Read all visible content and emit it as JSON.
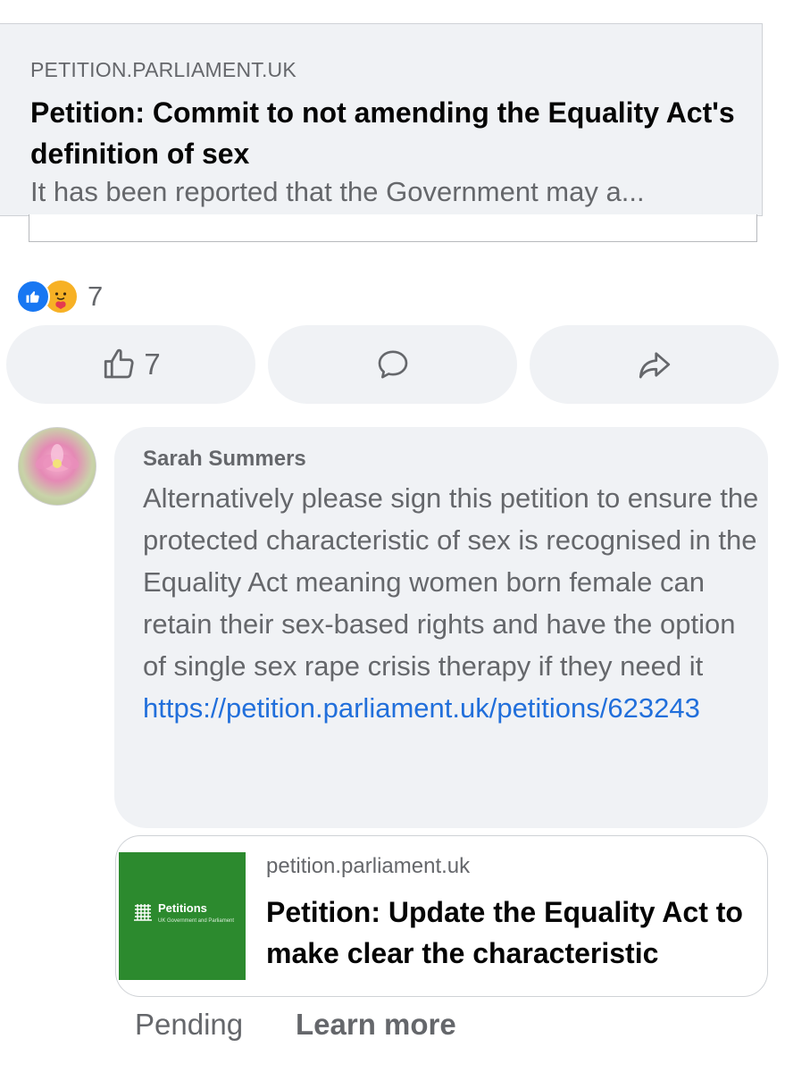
{
  "shared_link_card": {
    "domain": "PETITION.PARLIAMENT.UK",
    "title": "Petition: Commit to not amending the Equality Act's definition of sex",
    "description": "It has been reported that the Government may a..."
  },
  "reactions": {
    "icons": [
      "like-reaction-icon",
      "care-reaction-icon"
    ],
    "count": "7"
  },
  "actions": {
    "like_count": "7",
    "like_icon": "thumbs-up-icon",
    "comment_icon": "comment-bubble-icon",
    "share_icon": "share-arrow-icon"
  },
  "comment": {
    "author": "Sarah Summers",
    "text": "Alternatively please sign this petition to ensure the protected characteristic of sex is recognised in the Equality Act meaning women born female can retain their sex-based rights and have the option of single sex rape crisis therapy if they need it",
    "link": "https://petition.parliament.uk/petitions/623243",
    "link_preview": {
      "domain": "petition.parliament.uk",
      "title": "Petition: Update the Equality Act to make clear the characteristic",
      "thumbnail_brand": "Petitions",
      "thumbnail_sub": "UK Government and Parliament"
    },
    "status": "Pending",
    "learn_more": "Learn more"
  },
  "colors": {
    "card_bg": "#f0f2f5",
    "secondary_text": "#65676b",
    "link": "#216fdb",
    "like_blue": "#1877f2",
    "petitions_green": "#2c8a2e"
  }
}
